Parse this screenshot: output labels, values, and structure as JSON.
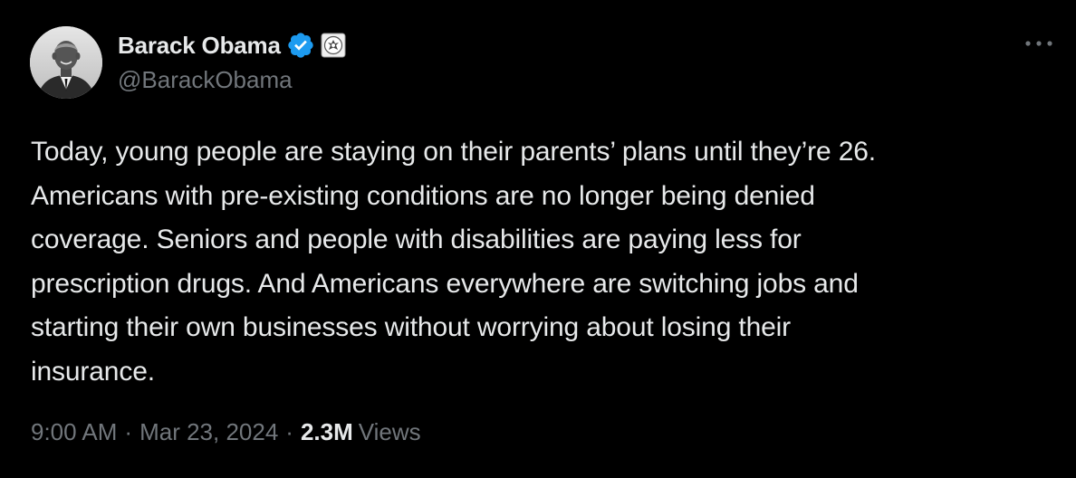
{
  "author": {
    "display_name": "Barack Obama",
    "handle": "@BarackObama",
    "verified_badge": "verified-checkmark-icon",
    "affiliation_badge": "government-seal-icon",
    "avatar": "author-avatar"
  },
  "menu": {
    "more_icon": "more-horizontal-icon"
  },
  "tweet": {
    "text_lines": [
      "Today, young people are staying on their parents’ plans until they’re 26.",
      "Americans with pre-existing conditions are no longer being denied",
      "coverage. Seniors and people with disabilities are paying less for",
      "prescription drugs. And Americans everywhere are switching jobs and",
      "starting their own businesses without worrying about losing their",
      "insurance."
    ]
  },
  "meta": {
    "time": "9:00 AM",
    "separator": "·",
    "date": "Mar 23, 2024",
    "views_count": "2.3M",
    "views_label": "Views"
  },
  "colors": {
    "background": "#000000",
    "primary_text": "#e7e9ea",
    "secondary_text": "#71767b",
    "verified_blue": "#1d9bf0"
  }
}
